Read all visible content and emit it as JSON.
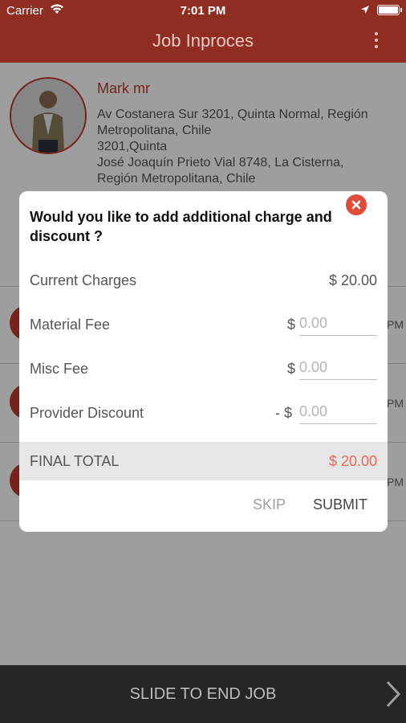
{
  "status_bar": {
    "carrier": "Carrier",
    "time": "7:01 PM"
  },
  "header": {
    "title": "Job Inproces"
  },
  "customer": {
    "name": "Mark mr",
    "address_lines": [
      "Av Costanera Sur 3201, Quinta Normal, Región",
      "Metropolitana, Chile",
      "3201,Quinta",
      "José Joaquín Prieto Vial 8748,  La Cisterna,",
      "Región Metropolitana,  Chile"
    ]
  },
  "background_rows": {
    "time_suffix": "PM"
  },
  "dialog": {
    "title": "Would you like to add additional charge and discount ?",
    "current_charges": {
      "label": "Current Charges",
      "value": "$ 20.00"
    },
    "material_fee": {
      "label": "Material Fee",
      "currency": "$",
      "placeholder": "0.00"
    },
    "misc_fee": {
      "label": "Misc Fee",
      "currency": "$",
      "placeholder": "0.00"
    },
    "provider_discount": {
      "label": "Provider Discount",
      "currency": "- $",
      "placeholder": "0.00"
    },
    "final_total": {
      "label": "FINAL TOTAL",
      "value": "$ 20.00"
    },
    "skip_label": "SKIP",
    "submit_label": "SUBMIT"
  },
  "bottom_bar": {
    "label": "SLIDE TO END JOB"
  },
  "colors": {
    "header": "#8f2d21",
    "accent": "#c0392b",
    "total": "#e8675a",
    "bottom_bar": "#262626"
  }
}
